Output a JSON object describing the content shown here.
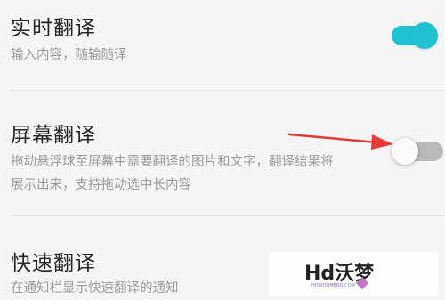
{
  "settings": [
    {
      "title": "实时翻译",
      "desc_line1": "输入内容，随输随译",
      "desc_line2": "",
      "enabled": true
    },
    {
      "title": "屏幕翻译",
      "desc_line1": "拖动悬浮球至屏幕中需要翻译的图片和文字，翻译结果将",
      "desc_line2": "展示出来，支持拖动选中长内容",
      "enabled": false
    },
    {
      "title": "快速翻译",
      "desc_line1": "在通知栏显示快速翻译的通知",
      "desc_line2": "",
      "enabled": null
    }
  ],
  "watermark": {
    "logo_text": "Hd沃梦",
    "subtext": "HDWOOMENG.COM"
  },
  "colors": {
    "toggle_on": "#1fc2d0",
    "toggle_off": "#b9b9b9",
    "annotation_arrow": "#e53935"
  },
  "icons": {
    "annotation": "red-arrow-icon"
  }
}
